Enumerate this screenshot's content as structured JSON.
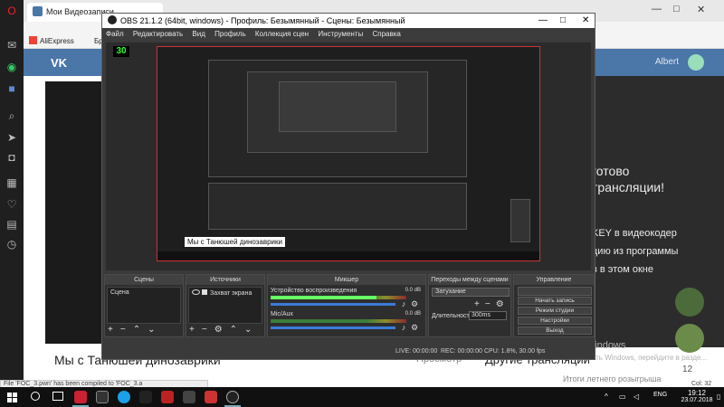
{
  "browser": {
    "tab_title": "Мои Видеозаписи",
    "bookmarks": [
      "AliExpress",
      "Бронирова"
    ],
    "vk_logo": "VK",
    "vk_user": "Albert",
    "stream_title": "Мы с Танюшей динозаврики",
    "watch_label": "Просмотр",
    "other_streams": "Другие трансляции",
    "other_streams_sub": "Итоги летнего розыгрыша",
    "right_lines": [
      "готово",
      "трансляции!"
    ],
    "right_small_lines": [
      "KEY в видеокодер",
      "цию из программы",
      "в в этом окне"
    ],
    "chat_count": "12",
    "status_text": "File 'FOC_3.pwn' has been compiled to 'FOC_3.a",
    "col_text": "Col: 32"
  },
  "windows_activation": {
    "title": "Активация Windows",
    "subtitle": "Чтобы активировать Windows, перейдите в разде..."
  },
  "obs": {
    "title": "OBS 21.1.2 (64bit, windows) - Профиль: Безымянный - Сцены: Безымянный",
    "menu": [
      "Файл",
      "Редактировать",
      "Вид",
      "Профиль",
      "Коллекция сцен",
      "Инструменты",
      "Справка"
    ],
    "fps": "30",
    "preview_caption": "Мы с Танюшей динозаврики",
    "docks": {
      "scenes_title": "Сцены",
      "sources_title": "Источники",
      "mixer_title": "Микшер",
      "transitions_title": "Переходы между сценами",
      "controls_title": "Управление"
    },
    "scenes": [
      "Сцена"
    ],
    "sources": [
      "Захват экрана"
    ],
    "mixer": [
      {
        "name": "Устройство воспроизведения",
        "db": "0.0 dB",
        "level": 0.78
      },
      {
        "name": "Мic/Aux",
        "db": "0.0 dB",
        "level": 0.0
      }
    ],
    "transition_select": "Затухание",
    "duration_label": "Длительность",
    "duration_value": "300ms",
    "controls": [
      "Начать трансляцию",
      "Начать запись",
      "Режим студии",
      "Настройки",
      "Выход"
    ],
    "status": {
      "live": "LIVE: 00:00:00",
      "rec": "REC: 00:00:00",
      "cpu": "CPU: 1.8%, 30.00 fps"
    }
  },
  "taskbar": {
    "lang": "ENG",
    "time": "19:12",
    "date": "23.07.2018"
  }
}
